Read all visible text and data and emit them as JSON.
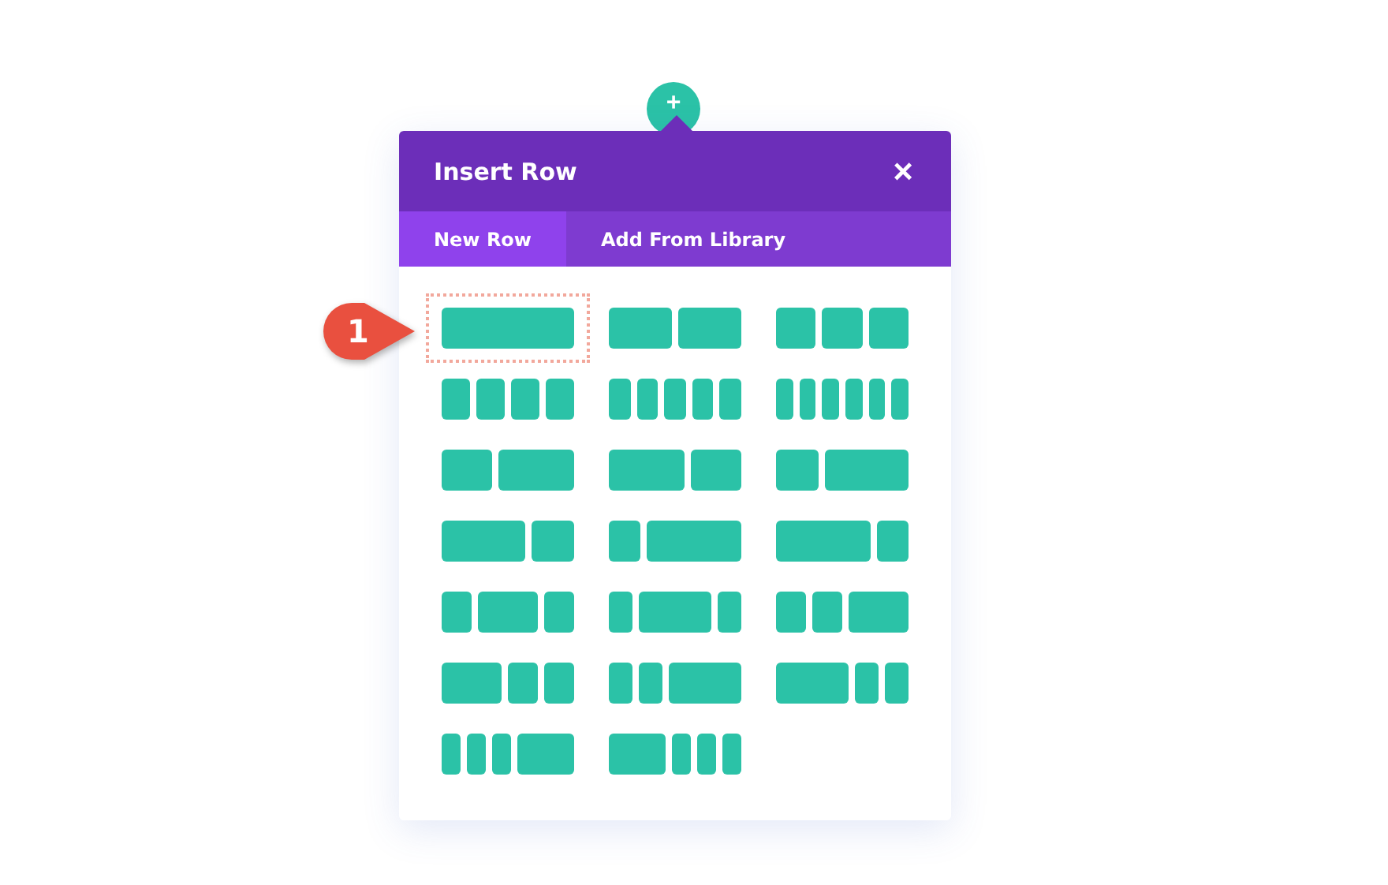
{
  "add_button": {
    "label": "+"
  },
  "dialog": {
    "title": "Insert Row",
    "close": "×"
  },
  "tabs": [
    {
      "label": "New Row",
      "selected": true
    },
    {
      "label": "Add From Library",
      "selected": false
    }
  ],
  "layouts": [
    {
      "kind": "full",
      "selected": true
    },
    {
      "kind": "halves",
      "selected": false
    },
    {
      "kind": "thirds",
      "selected": false
    },
    {
      "kind": "quarters",
      "selected": false
    },
    {
      "kind": "fifths",
      "selected": false
    },
    {
      "kind": "sixths",
      "selected": false
    },
    {
      "kind": "two-fifths-three-fifths",
      "selected": false
    },
    {
      "kind": "three-fifths-two-fifths",
      "selected": false
    },
    {
      "kind": "third-two-thirds",
      "selected": false
    },
    {
      "kind": "two-thirds-third",
      "selected": false
    },
    {
      "kind": "quarter-three-quarters",
      "selected": false
    },
    {
      "kind": "three-quarters-quarter",
      "selected": false
    },
    {
      "kind": "quarter-half-quarter",
      "selected": false
    },
    {
      "kind": "fifth-three-fifths-fifth",
      "selected": false
    },
    {
      "kind": "quarter-quarter-half",
      "selected": false
    },
    {
      "kind": "half-quarter-quarter",
      "selected": false
    },
    {
      "kind": "fifth-fifth-three-fifths",
      "selected": false
    },
    {
      "kind": "three-fifths-fifth-fifth",
      "selected": false
    },
    {
      "kind": "sixth-sixth-sixth-half",
      "selected": false
    },
    {
      "kind": "half-sixth-sixth-sixth",
      "selected": false
    }
  ],
  "callout": {
    "label": "1"
  }
}
